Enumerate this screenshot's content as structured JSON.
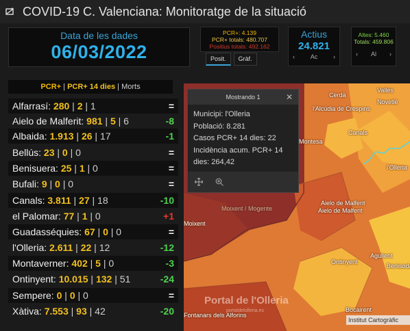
{
  "app": {
    "title": "COVID-19 C. Valenciana: Monitoratge de la situació"
  },
  "date_panel": {
    "label": "Data de les dades",
    "value": "06/03/2022"
  },
  "pcr_panel": {
    "pcr_plus": "PCR+: 4.139",
    "pcr_total": "PCR+ totals: 480.707",
    "positius": "Positius totals: 492.162"
  },
  "tabs": [
    {
      "label": "Posit."
    },
    {
      "label": "Gràf."
    }
  ],
  "actius_panel": {
    "label": "Actius",
    "value": "24.821",
    "prev": "‹",
    "page": "Ac",
    "next": "›"
  },
  "altes_panel": {
    "altes": "Altes: 5.460",
    "totals": "Totals: 459.806",
    "prev": "‹",
    "page": "Al",
    "next": "›"
  },
  "list_header": {
    "pcr": "PCR+",
    "sep1": " | ",
    "pcr14": "PCR+ 14 dies",
    "sep2": " | ",
    "morts": "Morts"
  },
  "municipalities": [
    {
      "name": "Alfarrasí:",
      "pcr": "280",
      "pcr14": "2",
      "morts": "1",
      "delta": "=",
      "kind": "eq"
    },
    {
      "name": "Aielo de Malferit:",
      "pcr": "981",
      "pcr14": "5",
      "morts": "6",
      "delta": "-8",
      "kind": "neg"
    },
    {
      "name": "Albaida:",
      "pcr": "1.913",
      "pcr14": "26",
      "morts": "17",
      "delta": "-1",
      "kind": "neg"
    },
    {
      "name": "Bellús:",
      "pcr": "23",
      "pcr14": "0",
      "morts": "0",
      "delta": "=",
      "kind": "eq"
    },
    {
      "name": "Benisuera:",
      "pcr": "25",
      "pcr14": "1",
      "morts": "0",
      "delta": "=",
      "kind": "eq"
    },
    {
      "name": "Bufali:",
      "pcr": "9",
      "pcr14": "0",
      "morts": "0",
      "delta": "=",
      "kind": "eq"
    },
    {
      "name": "Canals:",
      "pcr": "3.811",
      "pcr14": "27",
      "morts": "18",
      "delta": "-10",
      "kind": "neg"
    },
    {
      "name": "el Palomar:",
      "pcr": "77",
      "pcr14": "1",
      "morts": "0",
      "delta": "+1",
      "kind": "pos"
    },
    {
      "name": "Guadasséquies:",
      "pcr": "67",
      "pcr14": "0",
      "morts": "0",
      "delta": "=",
      "kind": "eq"
    },
    {
      "name": "l'Olleria:",
      "pcr": "2.611",
      "pcr14": "22",
      "morts": "12",
      "delta": "-12",
      "kind": "neg"
    },
    {
      "name": "Montaverner:",
      "pcr": "402",
      "pcr14": "5",
      "morts": "0",
      "delta": "-3",
      "kind": "neg"
    },
    {
      "name": "Ontinyent:",
      "pcr": "10.015",
      "pcr14": "132",
      "morts": "51",
      "delta": "-24",
      "kind": "neg"
    },
    {
      "name": "Sempere:",
      "pcr": "0",
      "pcr14": "0",
      "morts": "0",
      "delta": "=",
      "kind": "eq"
    },
    {
      "name": "Xàtiva:",
      "pcr": "7.553",
      "pcr14": "93",
      "morts": "42",
      "delta": "-20",
      "kind": "neg"
    }
  ],
  "popup": {
    "header": "Mostrando 1",
    "close": "✕",
    "municipi": "Municipi: l'Olleria",
    "poblacio": "Població: 8.281",
    "casos": "Casos PCR+ 14 dies: 22",
    "incidencia_a": "Incidència acum. PCR+ 14",
    "incidencia_b": "dies: 264,42"
  },
  "map": {
    "places": [
      "Cerdà",
      "Vallés",
      "Novetlè",
      "l'Alcúdia de Crespins",
      "Canals",
      "l'Olleria",
      "Montesa",
      "Aielo de Malferit",
      "Moixent / Mogente",
      "Ontinyent",
      "Agullent",
      "Benisoda",
      "Bocairent",
      "Fontanars dels Alforins",
      "Moixent",
      "Aielo de Malferit"
    ],
    "watermark": "Portal de l'Olleria",
    "watermark_sub": "portaldelolleria.es",
    "attribution": "Institut Cartogràfic"
  },
  "colors": {
    "accent": "#2fb1ea",
    "pcr": "#f2c01f",
    "negative": "#4fd14f",
    "positive": "#e8372a"
  }
}
